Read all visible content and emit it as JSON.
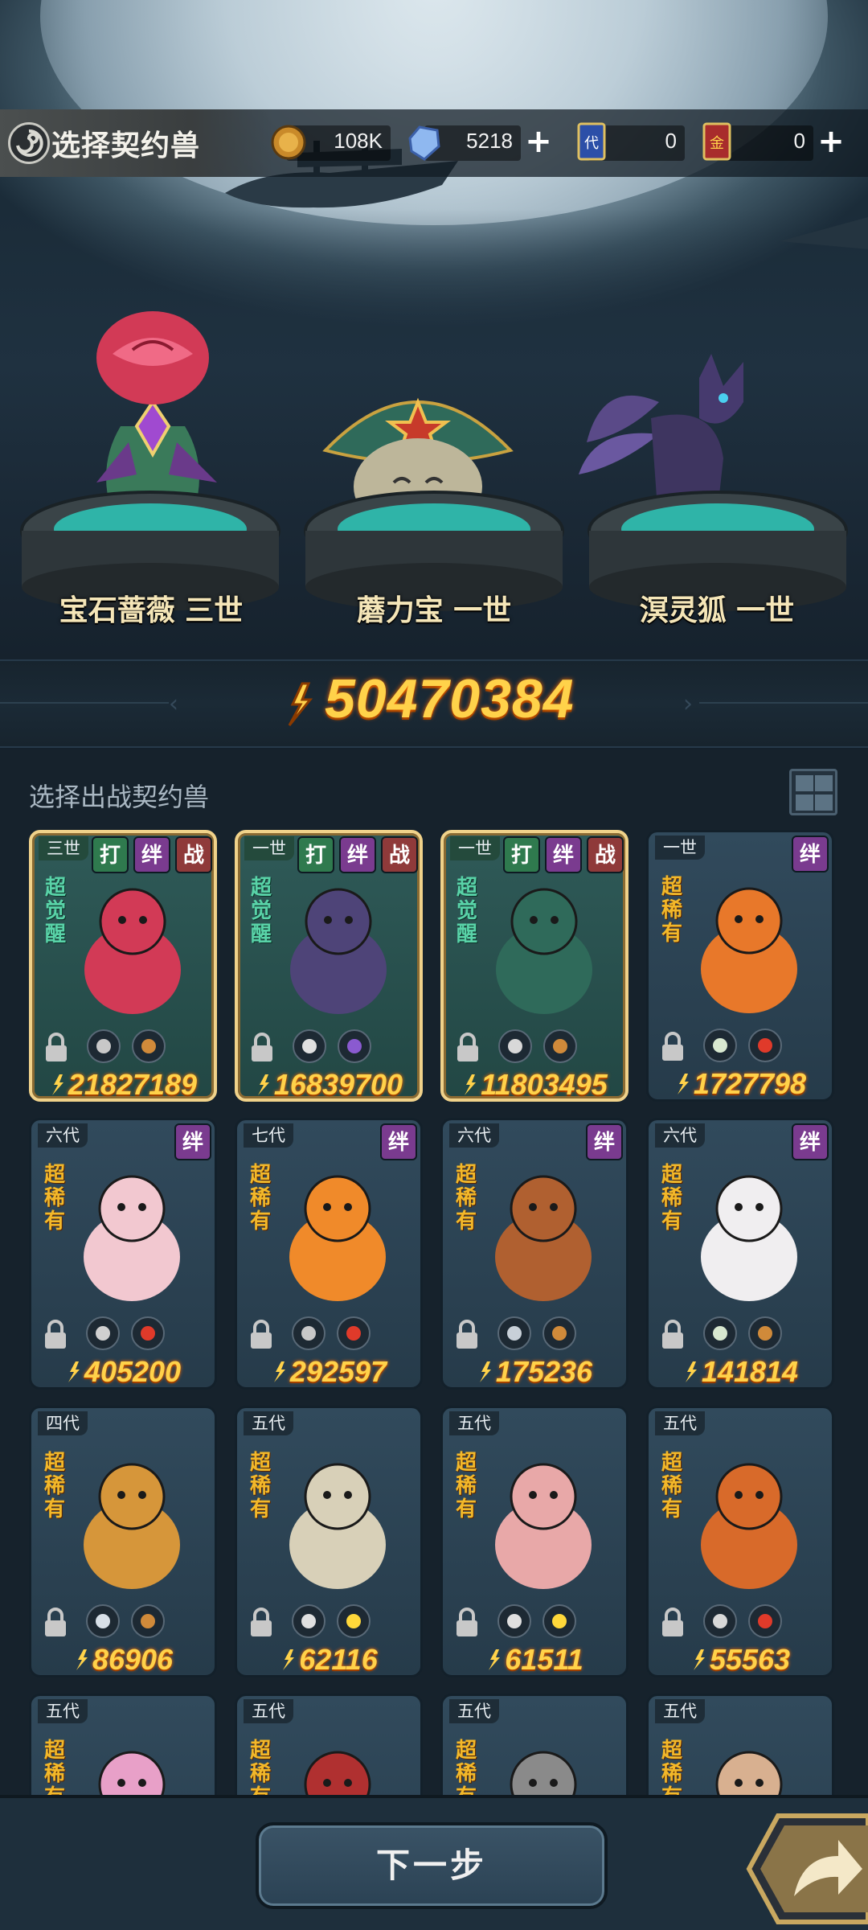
{
  "header": {
    "title": "选择契约兽",
    "resources": [
      {
        "name": "gold",
        "value": "108K",
        "has_plus": false
      },
      {
        "name": "diamond",
        "value": "5218",
        "has_plus": true
      },
      {
        "name": "blue-ticket",
        "value": "0",
        "has_plus": false
      },
      {
        "name": "red-ticket",
        "value": "0",
        "has_plus": true
      }
    ]
  },
  "featured": [
    {
      "name": "宝石蔷薇 三世"
    },
    {
      "name": "蘑力宝 一世"
    },
    {
      "name": "溟灵狐 一世"
    }
  ],
  "total_power": "50470384",
  "list": {
    "label": "选择出战契约兽",
    "cards": [
      {
        "gen": "三世",
        "tags": [
          "打",
          "绊",
          "战"
        ],
        "rarity": "超觉醒",
        "power": "21827189",
        "selected": true,
        "elements": [
          "shield",
          "earth"
        ],
        "art": "rose"
      },
      {
        "gen": "一世",
        "tags": [
          "打",
          "绊",
          "战"
        ],
        "rarity": "超觉醒",
        "power": "16839700",
        "selected": true,
        "elements": [
          "eye",
          "moon"
        ],
        "art": "fox"
      },
      {
        "gen": "一世",
        "tags": [
          "打",
          "绊",
          "战"
        ],
        "rarity": "超觉醒",
        "power": "11803495",
        "selected": true,
        "elements": [
          "claw",
          "earth"
        ],
        "art": "mushroom"
      },
      {
        "gen": "一世",
        "tags": [
          "绊"
        ],
        "rarity": "超稀有",
        "power": "1727798",
        "selected": false,
        "elements": [
          "leaf",
          "fire"
        ],
        "art": "butterfly"
      },
      {
        "gen": "六代",
        "tags": [
          "绊"
        ],
        "rarity": "超稀有",
        "power": "405200",
        "selected": false,
        "elements": [
          "skull",
          "fire"
        ],
        "art": "foxgirl"
      },
      {
        "gen": "七代",
        "tags": [
          "绊"
        ],
        "rarity": "超稀有",
        "power": "292597",
        "selected": false,
        "elements": [
          "shield",
          "fire"
        ],
        "art": "flame"
      },
      {
        "gen": "六代",
        "tags": [
          "绊"
        ],
        "rarity": "超稀有",
        "power": "175236",
        "selected": false,
        "elements": [
          "target",
          "earth"
        ],
        "art": "mole"
      },
      {
        "gen": "六代",
        "tags": [
          "绊"
        ],
        "rarity": "超稀有",
        "power": "141814",
        "selected": false,
        "elements": [
          "leaf",
          "earth"
        ],
        "art": "yeti"
      },
      {
        "gen": "四代",
        "tags": [],
        "rarity": "超稀有",
        "power": "86906",
        "selected": false,
        "elements": [
          "water",
          "earth"
        ],
        "art": "platypus"
      },
      {
        "gen": "五代",
        "tags": [],
        "rarity": "超稀有",
        "power": "62116",
        "selected": false,
        "elements": [
          "star",
          "light"
        ],
        "art": "dragon"
      },
      {
        "gen": "五代",
        "tags": [],
        "rarity": "超稀有",
        "power": "61511",
        "selected": false,
        "elements": [
          "star",
          "light"
        ],
        "art": "girl"
      },
      {
        "gen": "五代",
        "tags": [],
        "rarity": "超稀有",
        "power": "55563",
        "selected": false,
        "elements": [
          "claw",
          "fire"
        ],
        "art": "monkey"
      },
      {
        "gen": "五代",
        "tags": [],
        "rarity": "超稀有",
        "power": "",
        "selected": false,
        "elements": [],
        "art": "pink"
      },
      {
        "gen": "五代",
        "tags": [],
        "rarity": "超稀有",
        "power": "",
        "selected": false,
        "elements": [],
        "art": "red"
      },
      {
        "gen": "五代",
        "tags": [],
        "rarity": "超稀有",
        "power": "",
        "selected": false,
        "elements": [],
        "art": "knight"
      },
      {
        "gen": "五代",
        "tags": [],
        "rarity": "超稀有",
        "power": "",
        "selected": false,
        "elements": [],
        "art": "cat"
      }
    ]
  },
  "footer": {
    "next_label": "下一步"
  },
  "colors": {
    "power_gold": "#ffd24a",
    "selected_border": "#f0d28a",
    "card_bg": "#2c4354",
    "tag_da": "#2f7a4e",
    "tag_ban": "#7a3b8f",
    "tag_zhan": "#8f3a3a"
  }
}
